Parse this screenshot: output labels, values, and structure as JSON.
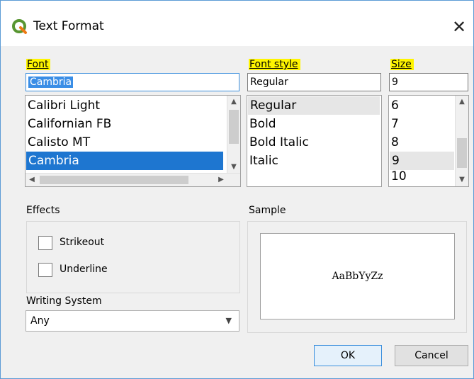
{
  "window": {
    "title": "Text Format",
    "close_glyph": "✕"
  },
  "font": {
    "label": "Font",
    "value": "Cambria",
    "items": [
      "Calibri Light",
      "Californian FB",
      "Calisto MT",
      "Cambria"
    ],
    "selected_index": 3
  },
  "font_style": {
    "label": "Font style",
    "value": "Regular",
    "items": [
      "Regular",
      "Bold",
      "Bold Italic",
      "Italic"
    ],
    "selected_index": 0
  },
  "size": {
    "label": "Size",
    "value": "9",
    "items": [
      "6",
      "7",
      "8",
      "9",
      "10"
    ],
    "selected_index": 3
  },
  "effects": {
    "label": "Effects",
    "strikeout_label": "Strikeout",
    "strikeout_checked": false,
    "underline_label": "Underline",
    "underline_checked": false
  },
  "writing_system": {
    "label": "Writing System",
    "value": "Any"
  },
  "sample": {
    "label": "Sample",
    "text": "AaBbYyZz"
  },
  "buttons": {
    "ok": "OK",
    "cancel": "Cancel"
  },
  "colors": {
    "accent": "#1e76d0",
    "highlight": "#fff500",
    "border": "#5b9bd5"
  },
  "icons": {
    "app": "qgis-logo-icon",
    "close": "close-icon"
  }
}
